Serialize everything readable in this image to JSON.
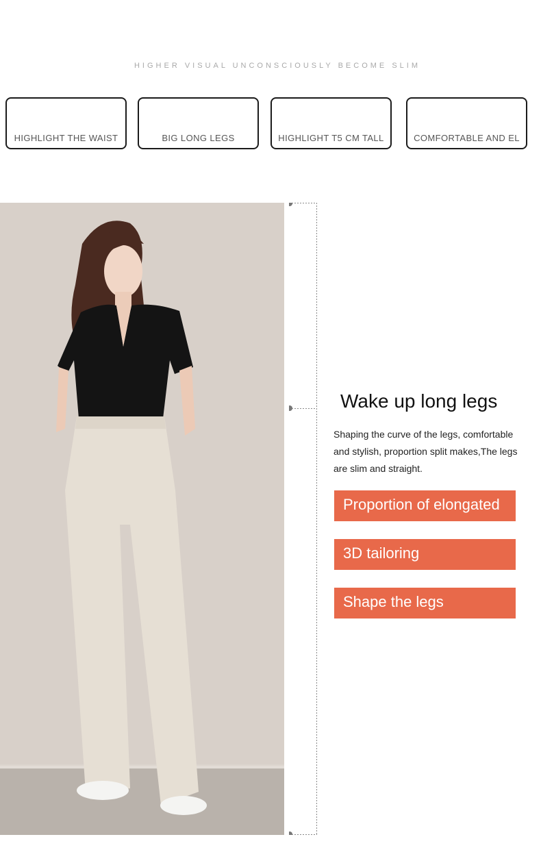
{
  "header": {
    "tagline": "HIGHER VISUAL UNCONSCIOUSLY BECOME SLIM"
  },
  "features": [
    {
      "label": "HIGHLIGHT THE WAIST"
    },
    {
      "label": "BIG LONG LEGS"
    },
    {
      "label": "HIGHLIGHT T5 CM TALL"
    },
    {
      "label": "COMFORTABLE AND EL"
    }
  ],
  "section": {
    "title": "Wake up long legs",
    "description": "Shaping the curve of the legs, comfortable and stylish, proportion split makes,The legs are slim and straight.",
    "tags": [
      {
        "label": "Proportion of elongated"
      },
      {
        "label": "3D tailoring"
      },
      {
        "label": "Shape the legs"
      }
    ]
  },
  "colors": {
    "accent": "#e8694a",
    "border": "#1a1a1a",
    "tagline": "#a9a9a9"
  }
}
